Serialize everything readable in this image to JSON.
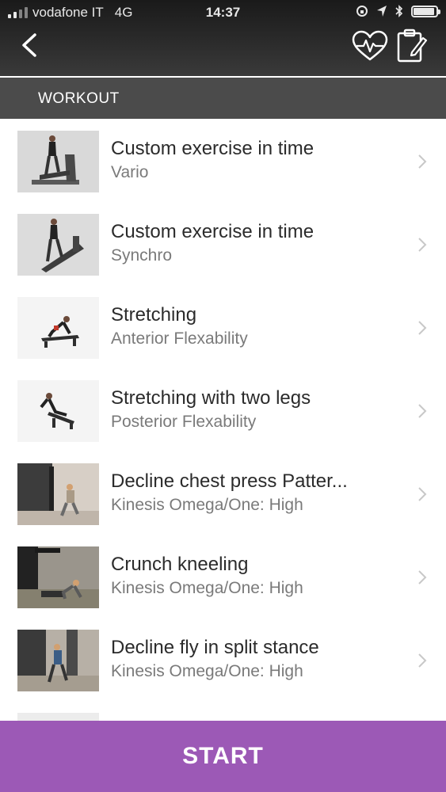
{
  "status_bar": {
    "carrier": "vodafone IT",
    "network": "4G",
    "time": "14:37"
  },
  "header": {
    "back_icon": "chevron-left-icon",
    "actions": [
      "heart-rate-icon",
      "clipboard-edit-icon"
    ]
  },
  "section": {
    "title": "WORKOUT"
  },
  "exercises": [
    {
      "title": "Custom exercise in time",
      "subtitle": "Vario",
      "thumb": "elliptical-machine"
    },
    {
      "title": "Custom exercise in time",
      "subtitle": "Synchro",
      "thumb": "cross-trainer"
    },
    {
      "title": "Stretching",
      "subtitle": "Anterior Flexability",
      "thumb": "stretch-lunge"
    },
    {
      "title": "Stretching with two legs",
      "subtitle": "Posterior Flexability",
      "thumb": "stretch-seated"
    },
    {
      "title": "Decline chest press Patter...",
      "subtitle": "Kinesis Omega/One: High",
      "thumb": "kinesis-wall"
    },
    {
      "title": "Crunch kneeling",
      "subtitle": "Kinesis Omega/One: High",
      "thumb": "kinesis-wall"
    },
    {
      "title": "Decline fly in split stance",
      "subtitle": "Kinesis Omega/One: High",
      "thumb": "kinesis-wall"
    }
  ],
  "footer": {
    "start_label": "START"
  },
  "colors": {
    "accent": "#9c59b6",
    "header_bg": "#2b2b2b",
    "section_bg": "#4b4b4b"
  }
}
